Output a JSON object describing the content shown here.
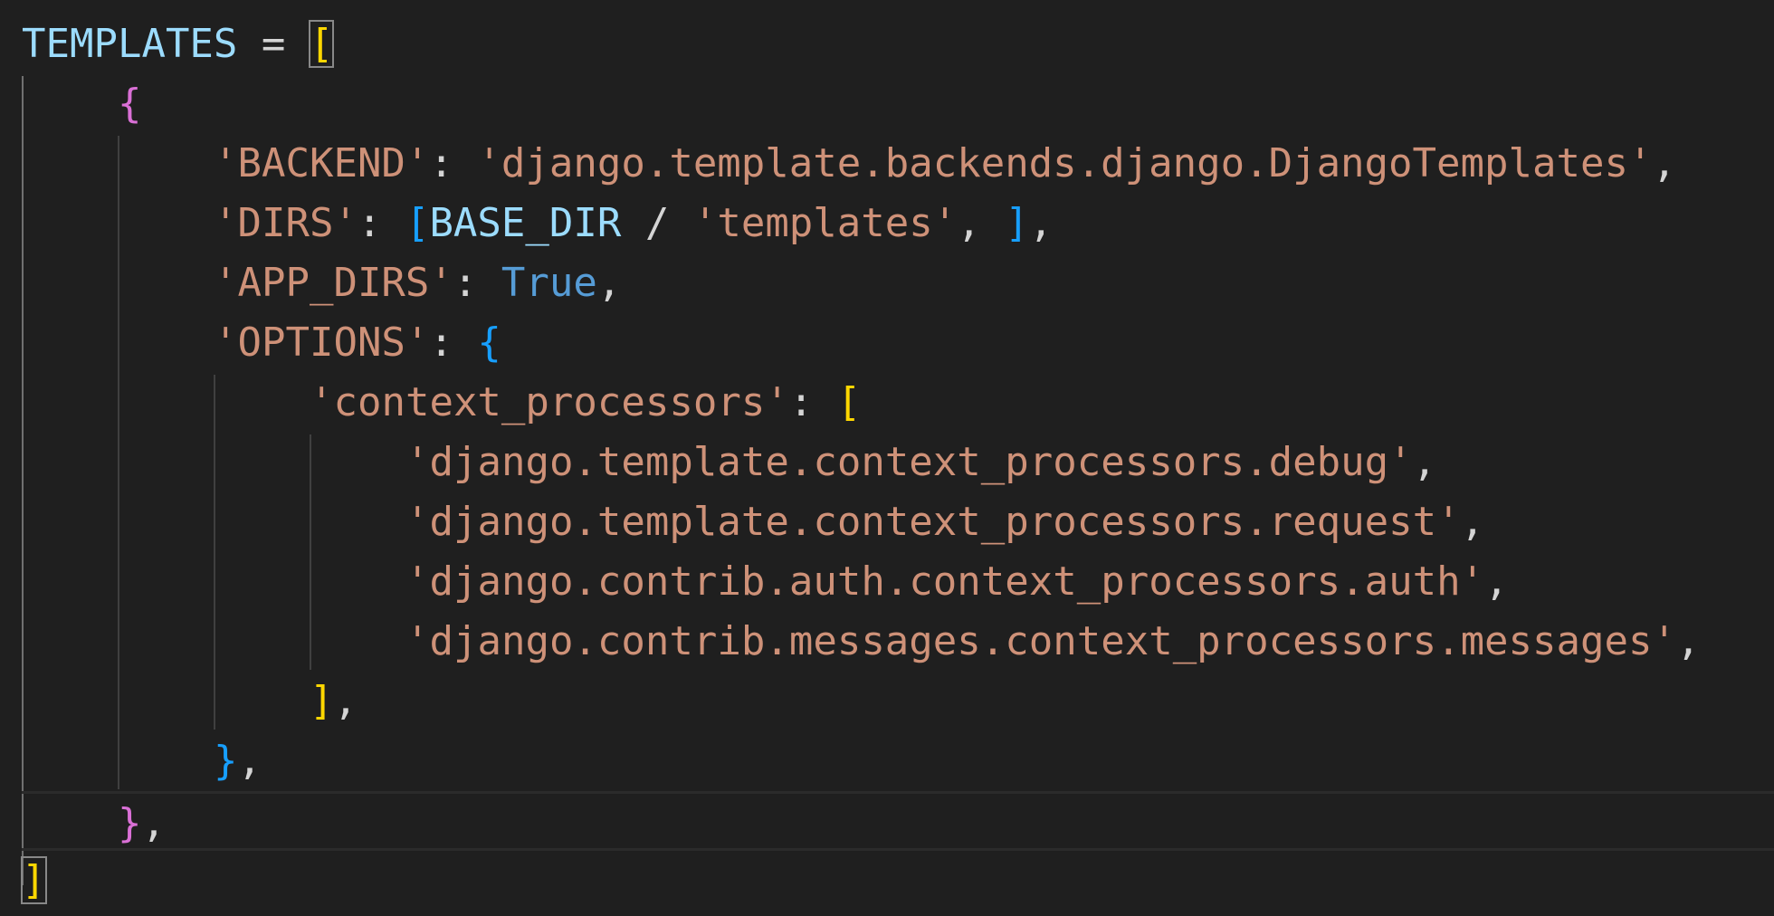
{
  "code": {
    "l1": {
      "var": "TEMPLATES",
      "op": " = ",
      "open": "["
    },
    "l2": {
      "open": "{"
    },
    "l3": {
      "key": "'BACKEND'",
      "colon": ": ",
      "value": "'django.template.backends.django.DjangoTemplates'",
      "comma": ","
    },
    "l4": {
      "key": "'DIRS'",
      "colon": ": ",
      "open": "[",
      "var": "BASE_DIR",
      "op": " / ",
      "value": "'templates'",
      "sep": ", ",
      "close": "]",
      "comma": ","
    },
    "l5": {
      "key": "'APP_DIRS'",
      "colon": ": ",
      "value": "True",
      "comma": ","
    },
    "l6": {
      "key": "'OPTIONS'",
      "colon": ": ",
      "open": "{"
    },
    "l7": {
      "key": "'context_processors'",
      "colon": ": ",
      "open": "["
    },
    "l8": {
      "value": "'django.template.context_processors.debug'",
      "comma": ","
    },
    "l9": {
      "value": "'django.template.context_processors.request'",
      "comma": ","
    },
    "l10": {
      "value": "'django.contrib.auth.context_processors.auth'",
      "comma": ","
    },
    "l11": {
      "value": "'django.contrib.messages.context_processors.messages'",
      "comma": ","
    },
    "l12": {
      "close": "]",
      "comma": ","
    },
    "l13": {
      "close": "}",
      "comma": ","
    },
    "l14": {
      "close": "}",
      "comma": ","
    },
    "l15": {
      "close": "]"
    }
  },
  "colors": {
    "background": "#1f1f1f",
    "variable": "#9cdcfe",
    "string": "#ce9178",
    "keyword": "#569cd6",
    "bracket_level1": "#ffd700",
    "bracket_level2": "#da70d6",
    "bracket_level3": "#179fff"
  }
}
